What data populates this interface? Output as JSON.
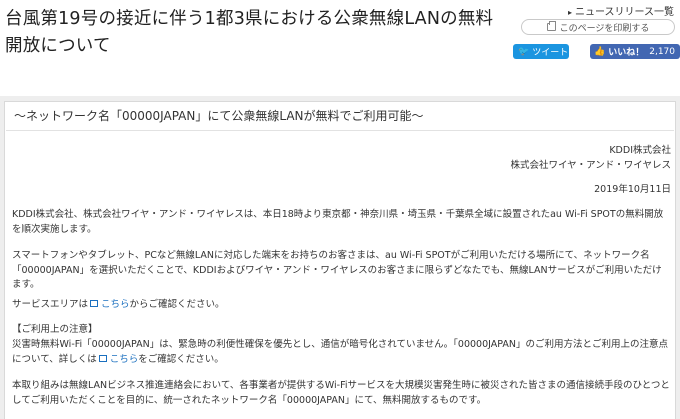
{
  "header": {
    "title": "台風第19号の接近に伴う1都3県における公衆無線LANの無料開放について",
    "news_link": "ニュースリリース一覧",
    "print_label": "このページを印刷する",
    "tweet_label": "ツイート",
    "like_label": "いいね！",
    "like_count": "2,170"
  },
  "article": {
    "subtitle": "～ネットワーク名「00000JAPAN」にて公衆無線LANが無料でご利用可能～",
    "company1": "KDDI株式会社",
    "company2": "株式会社ワイヤ・アンド・ワイヤレス",
    "date": "2019年10月11日",
    "p1": "KDDI株式会社、株式会社ワイヤ・アンド・ワイヤレスは、本日18時より東京都・神奈川県・埼玉県・千葉県全域に設置されたau Wi-Fi SPOTの無料開放を順次実施します。",
    "p2": "スマートフォンやタブレット、PCなど無線LANに対応した端末をお持ちのお客さまは、au Wi-Fi SPOTがご利用いただける場所にて、ネットワーク名「00000JAPAN」を選択いただくことで、KDDIおよびワイヤ・アンド・ワイヤレスのお客さまに限らずどなたでも、無線LANサービスがご利用いただけます。",
    "p3_prefix": "サービスエリアは",
    "p3_link": "こちら",
    "p3_suffix": "からご確認ください。",
    "notice_heading": "【ご利用上の注意】",
    "notice_text_prefix": "災害時無料Wi-Fi「00000JAPAN」は、緊急時の利便性確保を優先とし、通信が暗号化されていません。「00000JAPAN」のご利用方法とご利用上の注意点について、詳しくは",
    "notice_link": "こちら",
    "notice_suffix": "をご確認ください。",
    "p4": "本取り組みは無線LANビジネス推進連絡会において、各事業者が提供するWi-Fiサービスを大規模災害発生時に被災された皆さまの通信接続手段のひとつとしてご利用いただくことを目的に、統一されたネットワーク名「00000JAPAN」にて、無料開放するものです。"
  }
}
